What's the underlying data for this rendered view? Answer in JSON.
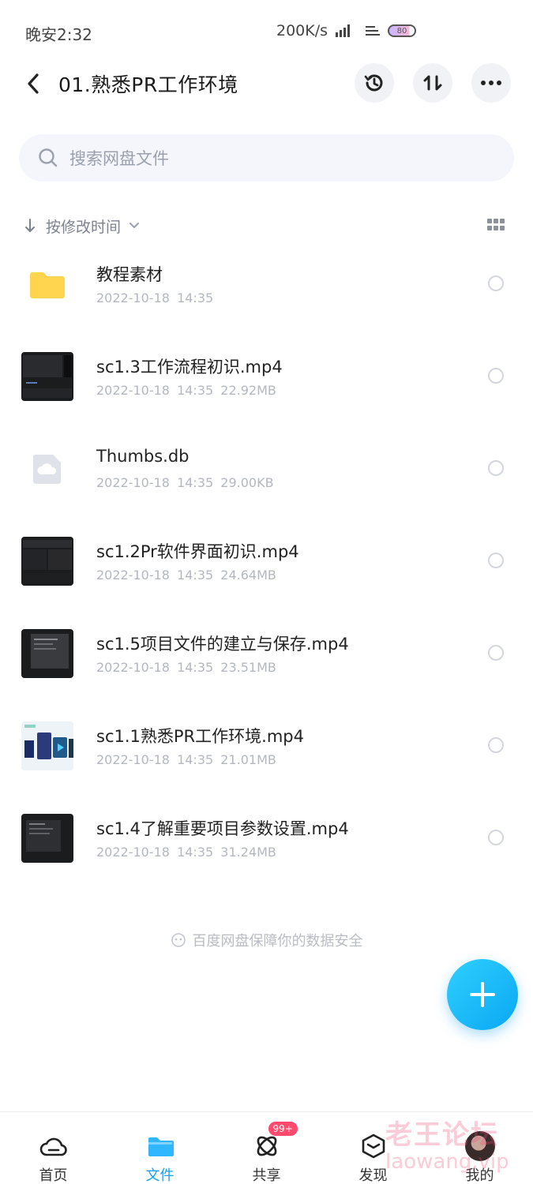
{
  "status": {
    "time": "晚安2:32",
    "network_speed": "200K/s",
    "battery": "80"
  },
  "header": {
    "title": "01.熟悉PR工作环境"
  },
  "search": {
    "placeholder": "搜索网盘文件"
  },
  "sort": {
    "label": "按修改时间"
  },
  "files": [
    {
      "name": "教程素材",
      "date": "2022-10-18  14:35",
      "size": "",
      "kind": "folder"
    },
    {
      "name": "sc1.3工作流程初识.mp4",
      "date": "2022-10-18  14:35",
      "size": "22.92MB",
      "kind": "video-dark"
    },
    {
      "name": "Thumbs.db",
      "date": "2022-10-18  14:35",
      "size": "29.00KB",
      "kind": "generic"
    },
    {
      "name": "sc1.2Pr软件界面初识.mp4",
      "date": "2022-10-18  14:35",
      "size": "24.64MB",
      "kind": "video-dark"
    },
    {
      "name": "sc1.5项目文件的建立与保存.mp4",
      "date": "2022-10-18  14:35",
      "size": "23.51MB",
      "kind": "video-dark"
    },
    {
      "name": "sc1.1熟悉PR工作环境.mp4",
      "date": "2022-10-18  14:35",
      "size": "21.01MB",
      "kind": "video-light"
    },
    {
      "name": "sc1.4了解重要项目参数设置.mp4",
      "date": "2022-10-18  14:35",
      "size": "31.24MB",
      "kind": "video-dark"
    }
  ],
  "footer": {
    "safety_note": "百度网盘保障你的数据安全"
  },
  "nav": {
    "home": "首页",
    "files": "文件",
    "share": "共享",
    "share_badge": "99+",
    "discover": "发现",
    "me": "我的"
  },
  "watermark": {
    "title": "老王论坛",
    "url": "laowang.vip"
  },
  "colors": {
    "accent": "#1aa0f0",
    "folder": "#ffd54f",
    "badge": "#ff4a6e"
  }
}
